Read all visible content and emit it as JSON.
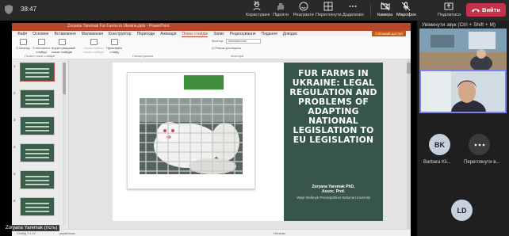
{
  "meeting": {
    "timer": "38:47",
    "toolbar": {
      "participants": {
        "label": "Користувачі",
        "count": "30"
      },
      "raise": {
        "label": "Підняти"
      },
      "react": {
        "label": "Реагувати"
      },
      "view": {
        "label": "Переглянути"
      },
      "more": {
        "label": "Додатково"
      },
      "camera": {
        "label": "Камера"
      },
      "mic": {
        "label": "Мікрофон"
      },
      "share": {
        "label": "Поділитися"
      },
      "leave": {
        "label": "Вийти"
      }
    },
    "accent_leave": "#c4314b"
  },
  "ppt": {
    "window_title": "Zoryana Yaremak Fur Farms in Ukraine.pptx - PowerPoint",
    "tabs": [
      "Файл",
      "Основне",
      "Вставлення",
      "Малювання",
      "Конструктор",
      "Переходи",
      "Анімація",
      "Показ слайдів",
      "Запис",
      "Рецензування",
      "Подання",
      "Довідка"
    ],
    "active_tab": "Показ слайдів",
    "share_button": "Спільний доступ",
    "ribbon": {
      "btn1": "З початку",
      "btn2": "З поточного слайда",
      "btn3": "Користувацький показ слайдів",
      "btn4": "Налаштувати показ слайдів",
      "btn5": "Приховати слайд",
      "group1": "Почати показ слайдів",
      "group2": "Налаштування",
      "monitor_label": "Монітор:",
      "monitor_value": "Автоматично",
      "presenter_view": "Режим доповідача",
      "group3": "Монітори"
    },
    "status": {
      "slide": "Слайд 1 з 12",
      "lang": "українська",
      "notes": "Нотатки"
    }
  },
  "slide": {
    "title": "FUR FARMS IN UKRAINE: LEGAL REGULATION AND PROBLEMS OF ADAPTING NATIONAL LEGISLATION TO EU LEGISLATION",
    "author_line1": "Zoryana Yaremak PhD,",
    "author_line2": "Assoc. Prof.",
    "university": "Vasyl Stefanyk Precarpathian National University"
  },
  "participants": {
    "unmute_note": "Увімкнути звук (Ctrl + Shift + M)",
    "presenter_name": "Zoryana Yaremak (гість)",
    "bk_initials": "BK",
    "bk_name": "Barbara Kli...",
    "more_label": "Переглянути в...",
    "ld_initials": "LD"
  }
}
